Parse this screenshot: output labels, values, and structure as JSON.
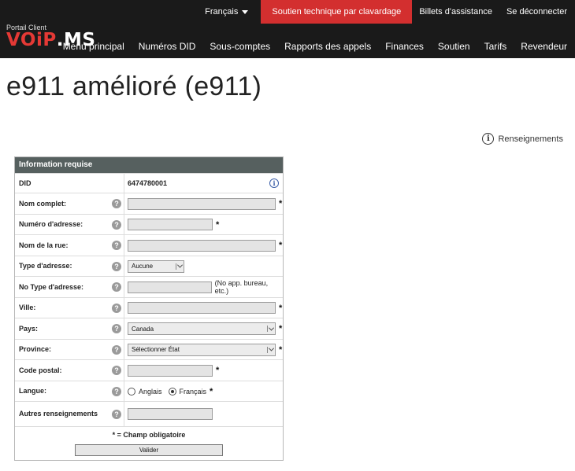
{
  "header": {
    "language": "Français",
    "chat_button": "Soutien technique par clavardage",
    "tickets": "Billets d'assistance",
    "logout": "Se déconnecter",
    "logo_caption": "Portail Client",
    "logo_text_red": "VOiP",
    "logo_text_white": ".MS",
    "nav": [
      "Menu principal",
      "Numéros DID",
      "Sous-comptes",
      "Rapports des appels",
      "Finances",
      "Soutien",
      "Tarifs",
      "Revendeur"
    ]
  },
  "page": {
    "title": "e911 amélioré (e911)",
    "info_link": "Renseignements"
  },
  "form": {
    "section_title": "Information requise",
    "did_label": "DID",
    "did_value": "6474780001",
    "fields": {
      "full_name": "Nom complet:",
      "address_number": "Numéro d'adresse:",
      "street_name": "Nom de la rue:",
      "address_type": "Type d'adresse:",
      "address_type_no": "No Type d'adresse:",
      "city": "Ville:",
      "country": "Pays:",
      "province": "Province:",
      "postal_code": "Code postal:",
      "language": "Langue:",
      "other_info": "Autres renseignements"
    },
    "address_type_value": "Aucune",
    "address_type_no_note": "(No app. bureau, etc.)",
    "country_value": "Canada",
    "province_value": "Sélectionner État",
    "language_options": [
      "Anglais",
      "Français"
    ],
    "language_selected": "Français",
    "required_mark": "*",
    "required_note": "* = Champ obligatoire",
    "submit_label": "Valider"
  }
}
